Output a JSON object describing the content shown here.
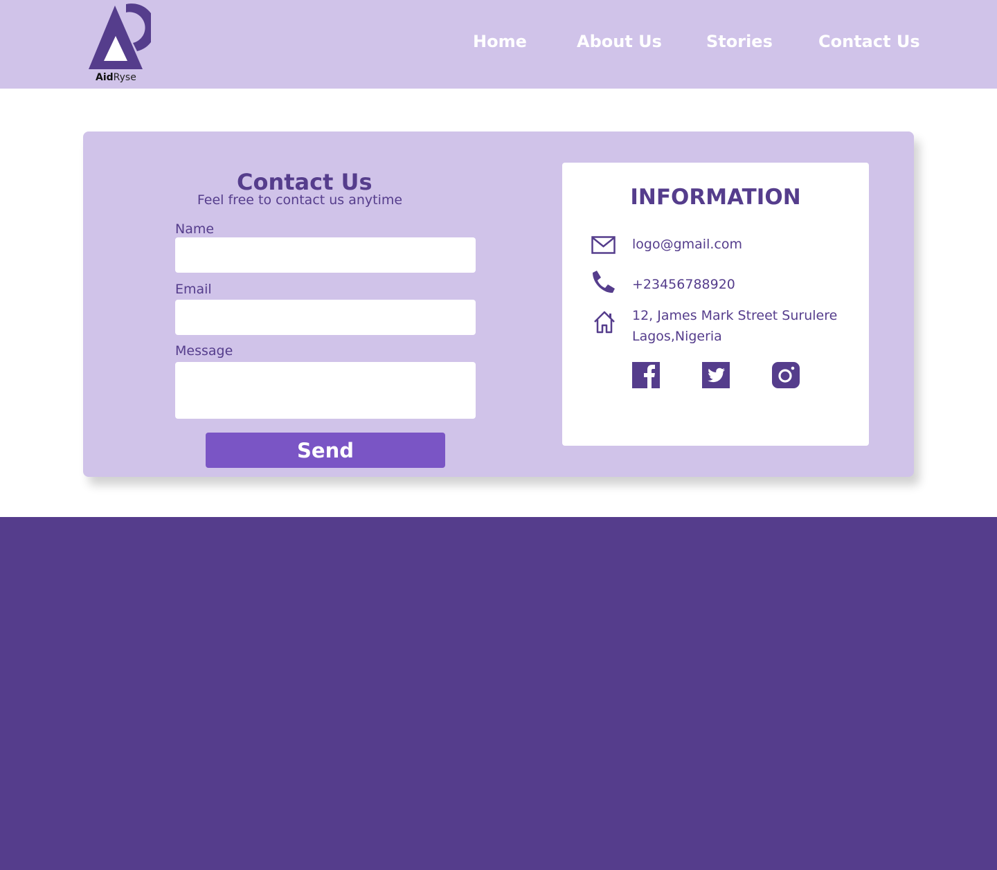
{
  "brand": {
    "name_bold": "Aid",
    "name_light": "Ryse",
    "primary_color": "#553d8c",
    "light_color": "#d0c3e9",
    "button_color": "#7a55c5"
  },
  "nav": {
    "items": [
      {
        "label": "Home"
      },
      {
        "label": "About Us"
      },
      {
        "label": "Stories"
      },
      {
        "label": "Contact Us"
      }
    ]
  },
  "contact_form": {
    "title": "Contact Us",
    "subtitle": "Feel free to contact us anytime",
    "name_label": "Name",
    "name_value": "",
    "email_label": "Email",
    "email_value": "",
    "message_label": "Message",
    "message_value": "",
    "send_label": "Send"
  },
  "information": {
    "title": "INFORMATION",
    "email": "logo@gmail.com",
    "phone": "+23456788920",
    "address_line1": "12, James Mark Street Surulere",
    "address_line2": "Lagos,Nigeria",
    "icons": [
      "mail-icon",
      "phone-icon",
      "home-icon"
    ],
    "social": [
      "facebook-icon",
      "twitter-icon",
      "instagram-icon"
    ]
  }
}
